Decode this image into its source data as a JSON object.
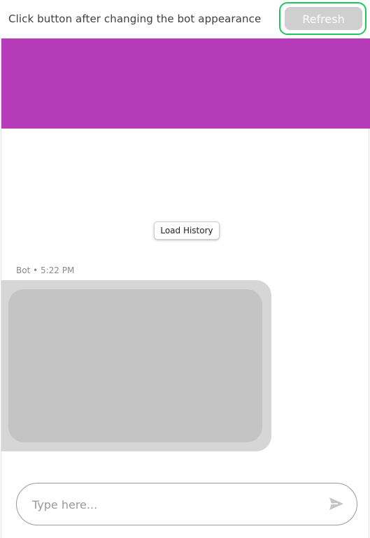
{
  "topbar": {
    "instruction": "Click button after changing the bot appearance",
    "refresh_label": "Refresh"
  },
  "chat": {
    "header_color": "#b63bb8",
    "load_history_label": "Load History",
    "message_meta": "Bot • 5:22 PM",
    "input_placeholder": "Type here...",
    "send_icon": "send-icon"
  },
  "colors": {
    "accent": "#22c55e",
    "button_bg": "#cfcfcf",
    "bubble_outer": "#d6d6d6",
    "bubble_inner": "#c4c4c4"
  }
}
